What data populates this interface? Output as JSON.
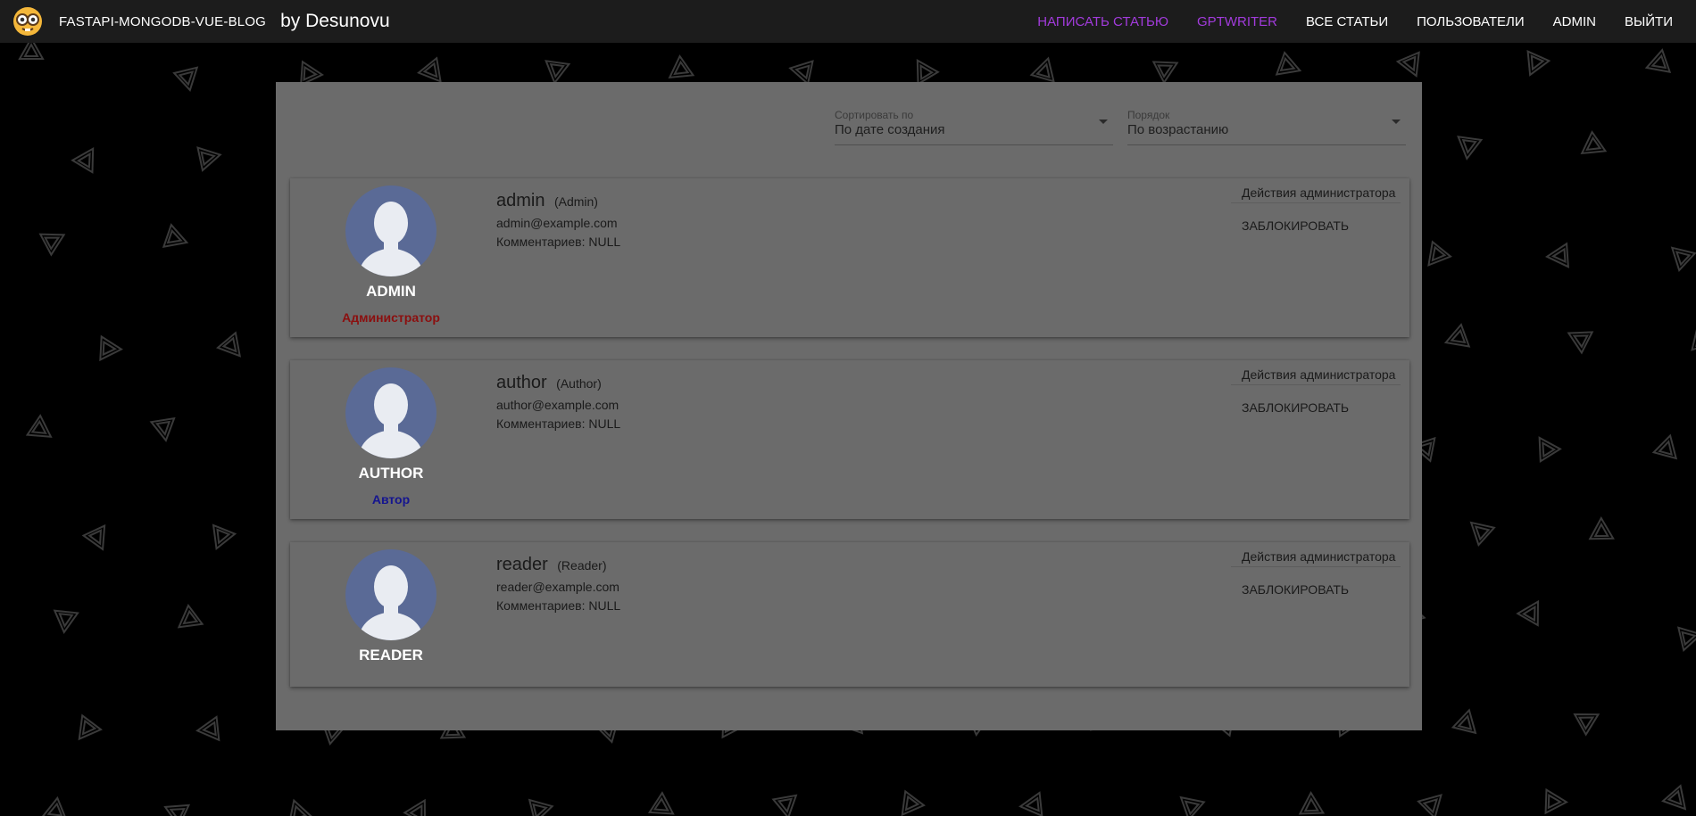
{
  "header": {
    "brand": "FASTAPI-MONGODB-VUE-BLOG",
    "by_line": "by Desunovu",
    "logo_icon": "nerd-emoji-icon",
    "nav": [
      {
        "label": "НАПИСАТЬ СТАТЬЮ",
        "accent": true
      },
      {
        "label": "GPTWRITER",
        "accent": true
      },
      {
        "label": "ВСЕ СТАТЬИ",
        "accent": false
      },
      {
        "label": "ПОЛЬЗОВАТЕЛИ",
        "accent": false
      },
      {
        "label": "ADMIN",
        "accent": false
      },
      {
        "label": "ВЫЙТИ",
        "accent": false
      }
    ],
    "accent_color": "#a23bdc"
  },
  "sort": {
    "sort_by_label": "Сортировать по",
    "sort_by_value": "По дате создания",
    "order_label": "Порядок",
    "order_value": "По возрастанию"
  },
  "users": [
    {
      "name": "admin",
      "name_caps": "ADMIN",
      "role": "(Admin)",
      "email": "admin@example.com",
      "comments": "Комментариев: NULL",
      "badge": "Администратор",
      "actions_title": "Действия администратора",
      "block_label": "ЗАБЛОКИРОВАТЬ"
    },
    {
      "name": "author",
      "name_caps": "AUTHOR",
      "role": "(Author)",
      "email": "author@example.com",
      "comments": "Комментариев: NULL",
      "badge": "Автор",
      "actions_title": "Действия администратора",
      "block_label": "ЗАБЛОКИРОВАТЬ"
    },
    {
      "name": "reader",
      "name_caps": "READER",
      "role": "(Reader)",
      "email": "reader@example.com",
      "comments": "Комментариев: NULL",
      "badge": "",
      "actions_title": "Действия администратора",
      "block_label": "ЗАБЛОКИРОВАТЬ"
    }
  ]
}
